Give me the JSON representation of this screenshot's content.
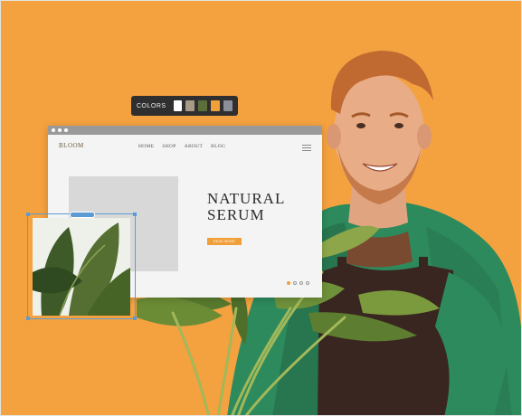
{
  "palette": {
    "label": "COLORS",
    "swatches": [
      {
        "name": "white",
        "color": "#ffffff"
      },
      {
        "name": "taupe",
        "color": "#a79a86"
      },
      {
        "name": "olive",
        "color": "#5c6e3a"
      },
      {
        "name": "orange",
        "color": "#f0a03a"
      },
      {
        "name": "slate",
        "color": "#8a8f99"
      }
    ]
  },
  "site": {
    "logo": "BLOOM",
    "nav": [
      "HOME",
      "SHOP",
      "ABOUT",
      "BLOG"
    ],
    "hero_line1": "NATURAL",
    "hero_line2": "SERUM",
    "cta_label": "READ MORE",
    "pager": {
      "total": 4,
      "active": 1
    }
  },
  "colors": {
    "background": "#f4a13f",
    "accent": "#f0a03a",
    "shirt": "#2d8a5c",
    "apron": "#3a2620",
    "selection": "#5b9bd5"
  }
}
